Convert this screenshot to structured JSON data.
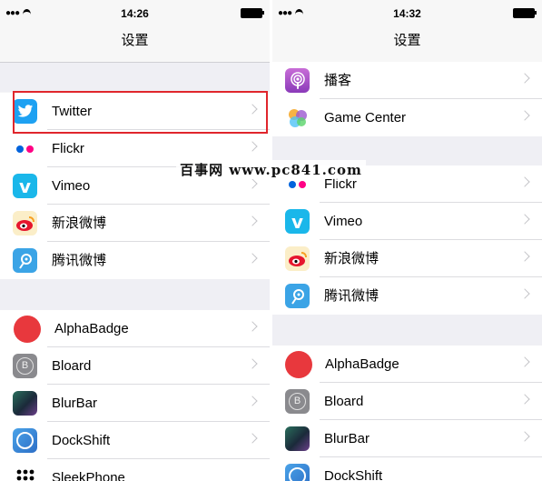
{
  "left": {
    "status": {
      "time": "14:26"
    },
    "nav_title": "设置",
    "rows": [
      {
        "label": "Twitter",
        "icon": "twitter-icon"
      },
      {
        "label": "Flickr",
        "icon": "flickr-icon"
      },
      {
        "label": "Vimeo",
        "icon": "vimeo-icon"
      },
      {
        "label": "新浪微博",
        "icon": "weibo-icon"
      },
      {
        "label": "腾讯微博",
        "icon": "tencent-weibo-icon"
      },
      {
        "label": "AlphaBadge",
        "icon": "alphabadge-icon"
      },
      {
        "label": "Bloard",
        "icon": "bloard-icon"
      },
      {
        "label": "BlurBar",
        "icon": "blurbar-icon"
      },
      {
        "label": "DockShift",
        "icon": "dockshift-icon"
      },
      {
        "label": "SleekPhone",
        "icon": "sleekphone-icon"
      }
    ]
  },
  "right": {
    "status": {
      "time": "14:32"
    },
    "nav_title": "设置",
    "rows": [
      {
        "label": "播客",
        "icon": "podcasts-icon"
      },
      {
        "label": "Game Center",
        "icon": "game-center-icon"
      },
      {
        "label": "Flickr",
        "icon": "flickr-icon"
      },
      {
        "label": "Vimeo",
        "icon": "vimeo-icon"
      },
      {
        "label": "新浪微博",
        "icon": "weibo-icon"
      },
      {
        "label": "腾讯微博",
        "icon": "tencent-weibo-icon"
      },
      {
        "label": "AlphaBadge",
        "icon": "alphabadge-icon"
      },
      {
        "label": "Bloard",
        "icon": "bloard-icon"
      },
      {
        "label": "BlurBar",
        "icon": "blurbar-icon"
      },
      {
        "label": "DockShift",
        "icon": "dockshift-icon"
      }
    ]
  },
  "watermark": "百事网 www.pc841.com",
  "colors": {
    "highlight": "#e0262c",
    "twitter": "#1da1f2",
    "vimeo": "#1ab7ea",
    "alphabadge": "#e8383d"
  }
}
